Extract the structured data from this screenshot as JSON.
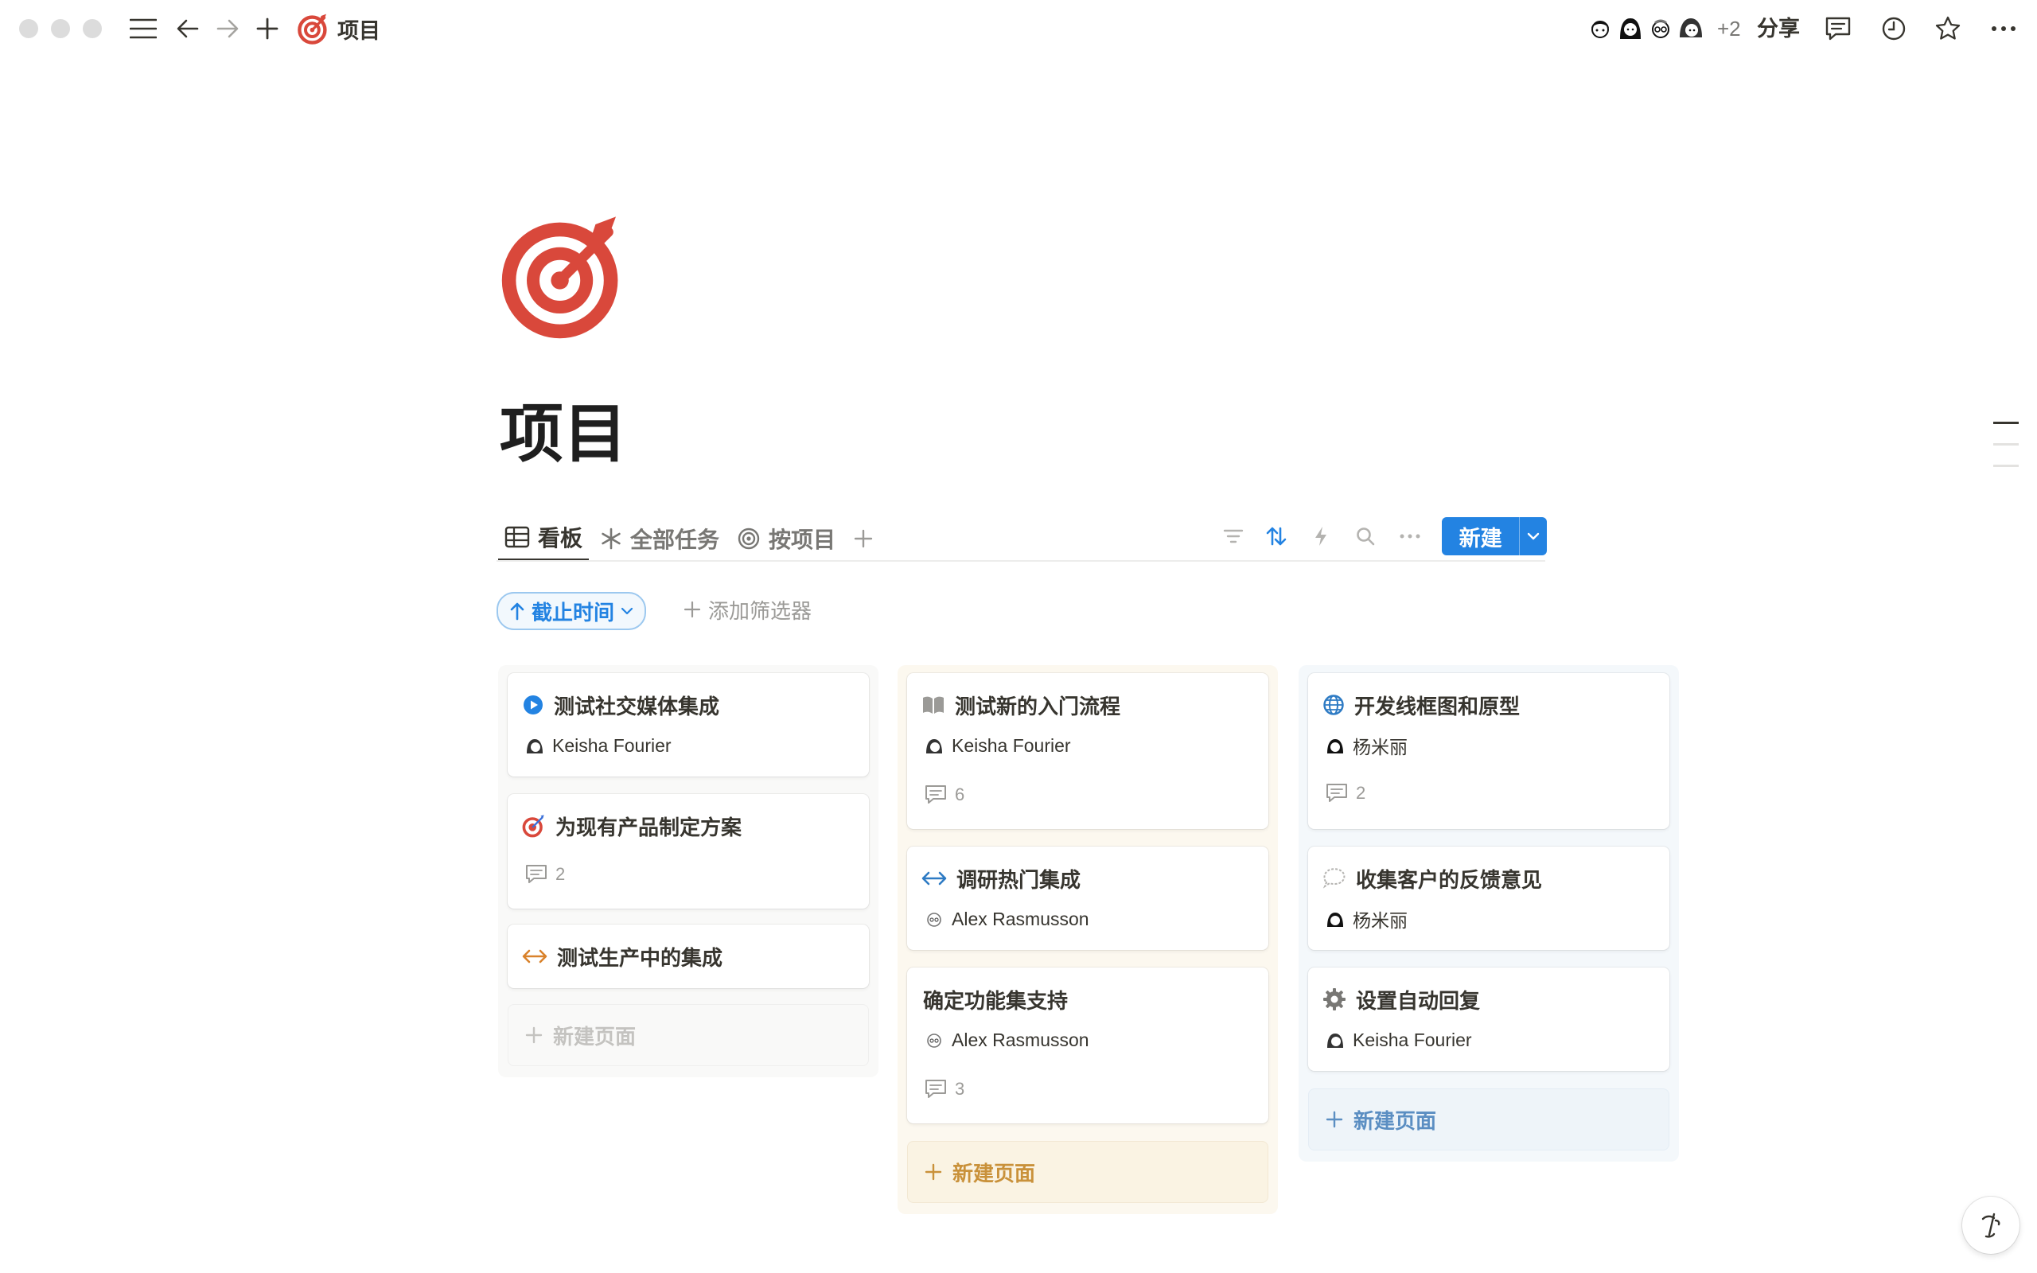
{
  "topbar": {
    "breadcrumb_title": "项目",
    "avatars_more": "+2",
    "share_label": "分享"
  },
  "page": {
    "title": "项目",
    "icon": "target-icon",
    "accent_color": "#d9483b"
  },
  "tabs": [
    {
      "label": "看板",
      "icon": "table-icon",
      "active": true
    },
    {
      "label": "全部任务",
      "icon": "asterisk-icon",
      "active": false
    },
    {
      "label": "按项目",
      "icon": "target-outline-icon",
      "active": false
    }
  ],
  "toolbar": {
    "new_label": "新建",
    "new_color": "#2383e2"
  },
  "filters": {
    "sort_label": "截止时间",
    "add_filter_label": "添加筛选器"
  },
  "board": {
    "columns": [
      {
        "new_page_label": "新建页面",
        "cards": [
          {
            "title": "测试社交媒体集成",
            "icon": "play-circle-icon",
            "person": "Keisha Fourier"
          },
          {
            "title": "为现有产品制定方案",
            "icon": "dart-target-icon",
            "comments": "2"
          },
          {
            "title": "测试生产中的集成",
            "icon": "arrows-horizontal-icon"
          }
        ]
      },
      {
        "new_page_label": "新建页面",
        "cards": [
          {
            "title": "测试新的入门流程",
            "icon": "book-icon",
            "person": "Keisha Fourier",
            "comments": "6"
          },
          {
            "title": "调研热门集成",
            "icon": "arrows-horizontal-icon",
            "person": "Alex Rasmusson"
          },
          {
            "title": "确定功能集支持",
            "person": "Alex Rasmusson",
            "comments": "3"
          }
        ]
      },
      {
        "new_page_label": "新建页面",
        "cards": [
          {
            "title": "开发线框图和原型",
            "icon": "globe-icon",
            "person": "杨米丽",
            "comments": "2"
          },
          {
            "title": "收集客户的反馈意见",
            "icon": "speech-bubble-icon",
            "person": "杨米丽"
          },
          {
            "title": "设置自动回复",
            "icon": "gear-icon",
            "person": "Keisha Fourier"
          }
        ]
      }
    ]
  }
}
